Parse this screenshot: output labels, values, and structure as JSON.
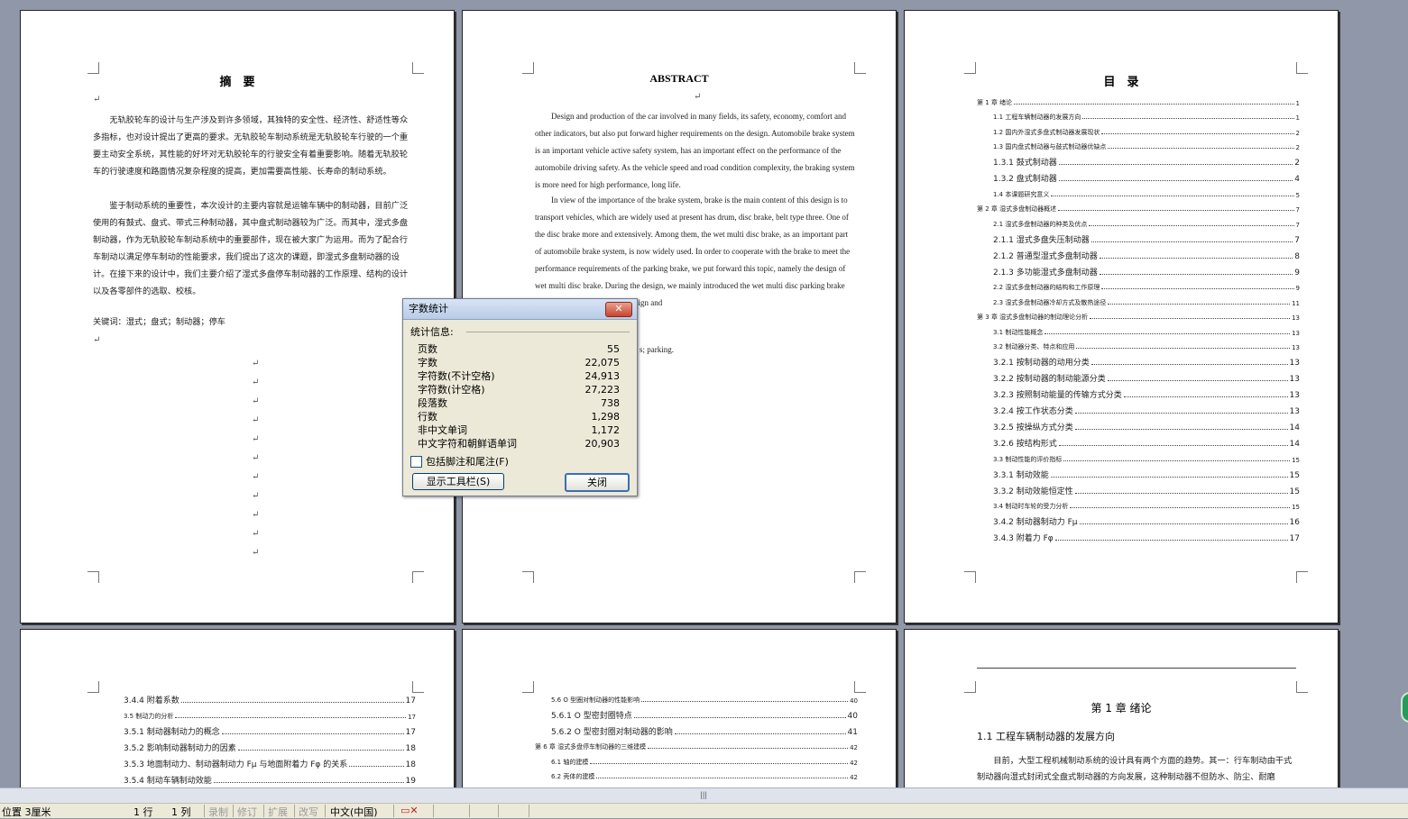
{
  "pages": {
    "abstract_cn": {
      "title": "摘　要",
      "paragraphs": [
        "无轨胶轮车的设计与生产涉及到许多领域，其独特的安全性、经济性、舒适性等众多指标，也对设计提出了更高的要求。无轨胶轮车制动系统是无轨胶轮车行驶的一个重要主动安全系统，其性能的好坏对无轨胶轮车的行驶安全有着重要影响。随着无轨胶轮车的行驶速度和路面情况复杂程度的提高，更加需要高性能、长寿命的制动系统。",
        "鉴于制动系统的重要性，本次设计的主要内容就是运输车辆中的制动器，目前广泛使用的有鼓式、盘式、带式三种制动器，其中盘式制动器较为广泛。而其中，湿式多盘制动器，作为无轨胶轮车制动系统中的重要部件，现在被大家广为运用。而为了配合行车制动以满足停车制动的性能要求，我们提出了这次的课题，即湿式多盘制动器的设计。在接下来的设计中，我们主要介绍了湿式多盘停车制动器的工作原理、结构的设计以及各零部件的选取、校核。"
      ],
      "keywords": "关键词：湿式；盘式；制动器；停车"
    },
    "abstract_en": {
      "title": "ABSTRACT",
      "paragraphs": [
        "Design and production of the car involved in many fields, its safety, economy, comfort and other indicators, but also put forward higher requirements on the design. Automobile brake system is an important vehicle active safety system, has an important effect on the performance of the automobile driving safety. As the vehicle speed and road condition complexity, the braking system is more need for high performance, long life.",
        "In view of the importance of the brake system, brake is the main content of this design is to transport vehicles, which are widely used at present has drum, disc brake, belt type three. One of the disc brake more and extensively. Among them, the wet multi disc brake, as an important part of automobile brake system, is now widely used. In order to cooperate with the brake to meet the performance requirements of the parking brake, we put forward this topic, namely the design of wet multi disc brake. During the design, we mainly introduced the wet multi disc parking brake working principle, structure design and"
      ],
      "keywords_tail": "s; parking."
    },
    "toc": {
      "title": "目　录",
      "entries": [
        {
          "t": "第 1 章  绪论",
          "p": "1",
          "lv": 0
        },
        {
          "t": "1.1  工程车辆制动器的发展方向",
          "p": "1",
          "lv": 1
        },
        {
          "t": "1.2  国内外湿式多盘式制动器发展现状",
          "p": "2",
          "lv": 1
        },
        {
          "t": "1.3  国内盘式制动器与鼓式制动器优缺点",
          "p": "2",
          "lv": 1
        },
        {
          "t": "1.3.1 鼓式制动器",
          "p": "2",
          "lv": 2
        },
        {
          "t": "1.3.2 盘式制动器",
          "p": "4",
          "lv": 2
        },
        {
          "t": "1.4  本课题研究意义",
          "p": "5",
          "lv": 1
        },
        {
          "t": "第 2 章  湿式多盘制动器概述",
          "p": "7",
          "lv": 0
        },
        {
          "t": "2.1  湿式多盘制动器的种类及优点",
          "p": "7",
          "lv": 1
        },
        {
          "t": "2.1.1  湿式多盘失压制动器",
          "p": "7",
          "lv": 2
        },
        {
          "t": "2.1.2  普通型湿式多盘制动器",
          "p": "8",
          "lv": 2
        },
        {
          "t": "2.1.3  多功能湿式多盘制动器",
          "p": "9",
          "lv": 2
        },
        {
          "t": "2.2  湿式多盘制动器的结构和工作原理",
          "p": "9",
          "lv": 1
        },
        {
          "t": "2.3  湿式多盘制动器冷却方式及散热途径",
          "p": "11",
          "lv": 1
        },
        {
          "t": "第 3 章  湿式多盘制动器的制动理论分析",
          "p": "13",
          "lv": 0
        },
        {
          "t": "3.1  制动性能概念",
          "p": "13",
          "lv": 1
        },
        {
          "t": "3.2  制动器分类、特点和应用",
          "p": "13",
          "lv": 1
        },
        {
          "t": "3.2.1 按制动器的动用分类",
          "p": "13",
          "lv": 2
        },
        {
          "t": "3.2.2  按制动器的制动能源分类",
          "p": "13",
          "lv": 2
        },
        {
          "t": "3.2.3  按照制动能量的传输方式分类",
          "p": "13",
          "lv": 2
        },
        {
          "t": "3.2.4  按工作状态分类",
          "p": "13",
          "lv": 2
        },
        {
          "t": "3.2.5  按操纵方式分类",
          "p": "14",
          "lv": 2
        },
        {
          "t": "3.2.6  按结构形式",
          "p": "14",
          "lv": 2
        },
        {
          "t": "3.3  制动性能的评价指标",
          "p": "15",
          "lv": 1
        },
        {
          "t": "3.3.1 制动效能",
          "p": "15",
          "lv": 2
        },
        {
          "t": "3.3.2 制动效能恒定性",
          "p": "15",
          "lv": 2
        },
        {
          "t": "3.4 制动时车轮的受力分析",
          "p": "15",
          "lv": 1
        },
        {
          "t": "3.4.2  制动器制动力 Fμ",
          "p": "16",
          "lv": 2
        },
        {
          "t": "3.4.3  附着力 Fφ",
          "p": "17",
          "lv": 2
        }
      ]
    },
    "toc2": {
      "entries": [
        {
          "t": "3.4.4  附着系数",
          "p": "17",
          "lv": 2
        },
        {
          "t": "3.5  制动力的分析",
          "p": "17",
          "lv": 1
        },
        {
          "t": "3.5.1  制动器制动力的概念",
          "p": "17",
          "lv": 2
        },
        {
          "t": "3.5.2  影响制动器制动力的因素",
          "p": "18",
          "lv": 2
        },
        {
          "t": "3.5.3  地面制动力、制动器制动力 Fμ 与地面附着力 Fφ 的关系",
          "p": "18",
          "lv": 2
        },
        {
          "t": "3.5.4  制动车辆制动效能",
          "p": "19",
          "lv": 2
        }
      ]
    },
    "toc3": {
      "entries": [
        {
          "t": "5.6 O 型圈对制动器的性能影响",
          "p": "40",
          "lv": 1
        },
        {
          "t": "5.6.1 O 型密封圈特点",
          "p": "40",
          "lv": 2
        },
        {
          "t": "5.6.2 O 型密封圈对制动器的影响",
          "p": "41",
          "lv": 2
        },
        {
          "t": "第 6 章  湿式多盘停车制动器的三维建模",
          "p": "42",
          "lv": 0
        },
        {
          "t": "6.1 轴的建模",
          "p": "42",
          "lv": 1
        },
        {
          "t": "6.2 壳体的建模",
          "p": "42",
          "lv": 1
        }
      ]
    },
    "chapter1": {
      "title": "第 1 章  绪论",
      "section": "1.1  工程车辆制动器的发展方向",
      "text": "目前，大型工程机械制动系统的设计具有两个方面的趋势。其一：行车制动由干式制动器向湿式封闭式全盘式制动器的方向发展，这种制动器不但防水、防尘、耐磨"
    }
  },
  "dialog": {
    "title": "字数统计",
    "close_x": "✕",
    "group_label": "统计信息:",
    "stats": [
      {
        "label": "页数",
        "value": "55"
      },
      {
        "label": "字数",
        "value": "22,075"
      },
      {
        "label": "字符数(不计空格)",
        "value": "24,913"
      },
      {
        "label": "字符数(计空格)",
        "value": "27,223"
      },
      {
        "label": "段落数",
        "value": "738"
      },
      {
        "label": "行数",
        "value": "1,298"
      },
      {
        "label": "非中文单词",
        "value": "1,172"
      },
      {
        "label": "中文字符和朝鲜语单词",
        "value": "20,903"
      }
    ],
    "checkbox_label": "包括脚注和尾注(F)",
    "toolbar_button": "显示工具栏(S)",
    "close_button": "关闭"
  },
  "status": {
    "position": "位置 3厘米",
    "line": "1 行",
    "col": "1 列",
    "rec": "录制",
    "trk": "修订",
    "ext": "扩展",
    "ovr": "改写",
    "lang": "中文(中国)"
  }
}
